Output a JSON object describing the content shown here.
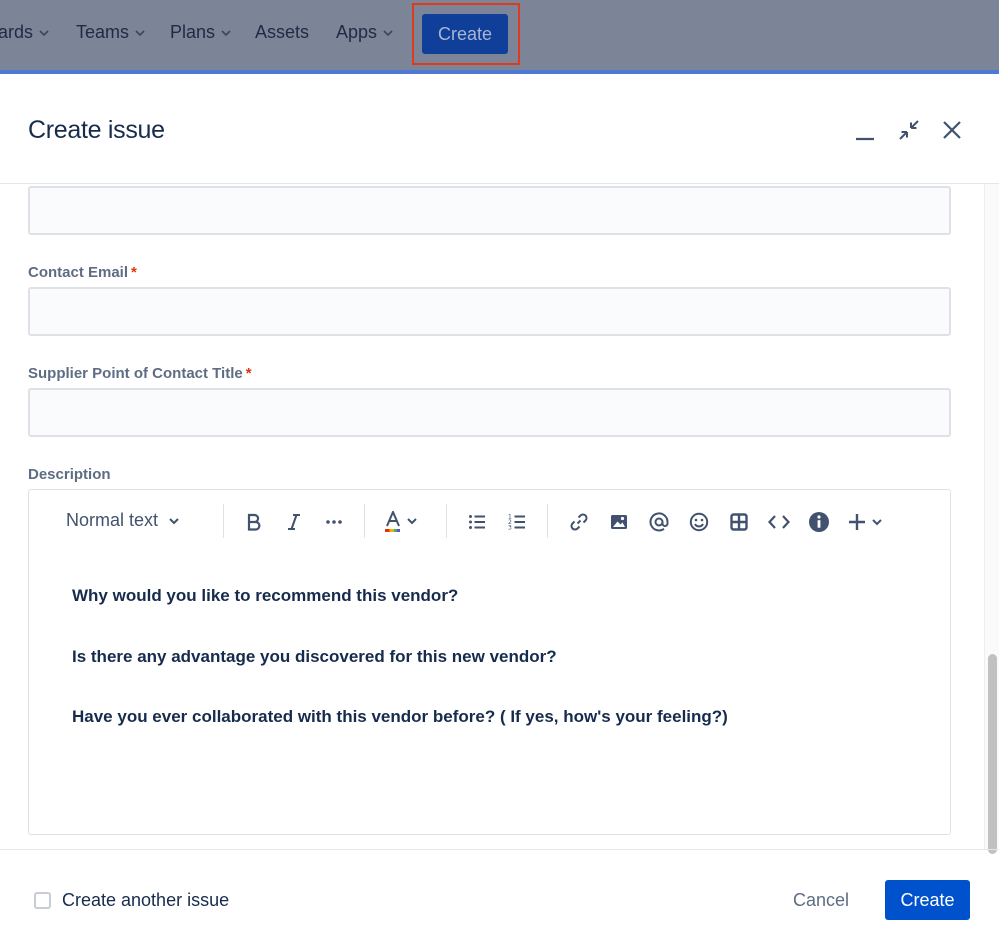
{
  "topnav": {
    "items": [
      {
        "label": "ards"
      },
      {
        "label": "Teams"
      },
      {
        "label": "Plans"
      },
      {
        "label": "Assets"
      },
      {
        "label": "Apps"
      }
    ],
    "create_label": "Create"
  },
  "modal": {
    "title": "Create issue",
    "fields": {
      "contact_email_label": "Contact Email",
      "supplier_poc_title_label": "Supplier Point of Contact Title",
      "required_marker": "*",
      "description_label": "Description"
    },
    "editor": {
      "text_style": "Normal text",
      "paragraphs": [
        "Why would you like to recommend this vendor?",
        "Is there any advantage you discovered for this new vendor?",
        "Have you ever collaborated with this vendor before? ( If yes, how's your feeling?)"
      ],
      "toolbar_icons": [
        "bold-icon",
        "italic-icon",
        "more-formatting-icon",
        "text-color-icon",
        "bullet-list-icon",
        "numbered-list-icon",
        "link-icon",
        "image-icon",
        "mention-icon",
        "emoji-icon",
        "table-icon",
        "code-icon",
        "info-panel-icon",
        "insert-plus-icon"
      ]
    },
    "footer": {
      "create_another_label": "Create another issue",
      "create_another_checked": false,
      "cancel_label": "Cancel",
      "create_label": "Create"
    }
  },
  "colors": {
    "primary": "#0052cc",
    "highlight_border": "#e03a1e",
    "required": "#de350b"
  }
}
